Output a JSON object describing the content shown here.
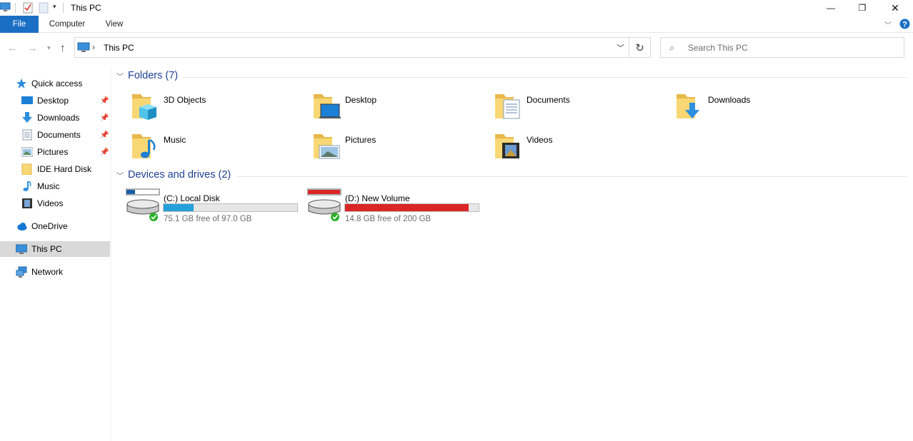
{
  "window": {
    "title": "This PC"
  },
  "window_controls": {
    "minimize": "—",
    "maximize": "❐",
    "close": "✕"
  },
  "ribbon": {
    "tabs": [
      "File",
      "Computer",
      "View"
    ]
  },
  "address": {
    "path": "This PC",
    "separator": "›"
  },
  "search": {
    "placeholder": "Search This PC"
  },
  "nav_pane": {
    "quick_access": "Quick access",
    "items": [
      "Desktop",
      "Downloads",
      "Documents",
      "Pictures",
      "IDE Hard Disk",
      "Music",
      "Videos"
    ],
    "onedrive": "OneDrive",
    "this_pc": "This PC",
    "network": "Network"
  },
  "folders_group": {
    "label": "Folders (7)"
  },
  "folders": [
    {
      "name": "3D Objects",
      "icon": "3d-objects-icon"
    },
    {
      "name": "Desktop",
      "icon": "desktop-folder-icon"
    },
    {
      "name": "Documents",
      "icon": "documents-folder-icon"
    },
    {
      "name": "Downloads",
      "icon": "downloads-folder-icon"
    },
    {
      "name": "Music",
      "icon": "music-folder-icon"
    },
    {
      "name": "Pictures",
      "icon": "pictures-folder-icon"
    },
    {
      "name": "Videos",
      "icon": "videos-folder-icon"
    }
  ],
  "drives_group": {
    "label": "Devices and drives (2)"
  },
  "drives": [
    {
      "name": "(C:) Local Disk",
      "free_text": "75.1 GB free of 97.0 GB",
      "used_fraction": 0.226,
      "bar_color": "#26a0da"
    },
    {
      "name": "(D:) New Volume",
      "free_text": "14.8 GB free of 200 GB",
      "used_fraction": 0.926,
      "bar_color": "#da2626"
    }
  ],
  "colors": {
    "accent": "#1a6fc4",
    "group_header": "#1e3f93",
    "folder": "#f5d166"
  }
}
